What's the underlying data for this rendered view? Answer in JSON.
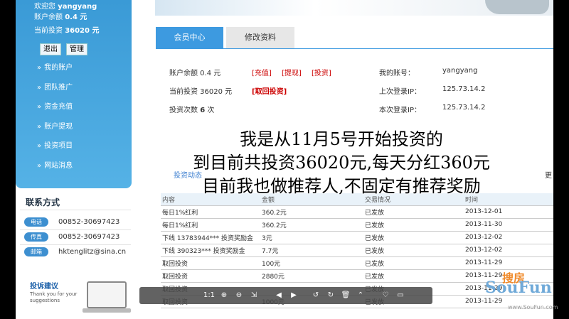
{
  "sidebar": {
    "welcome": "欢迎您",
    "username": "yangyang",
    "balance_label": "账户余额",
    "balance_value": "0.4 元",
    "investment_label": "当前投资",
    "investment_value": "36020 元",
    "logout_label": "退出",
    "manage_label": "管理",
    "menu": [
      "我的账户",
      "团队推广",
      "资金充值",
      "账户提现",
      "投资项目",
      "网站消息"
    ],
    "contact_title": "联系方式",
    "contacts": [
      {
        "tag": "电话",
        "value": "00852-30697423"
      },
      {
        "tag": "传真",
        "value": "00852-30697423"
      },
      {
        "tag": "邮箱",
        "value": "hktenglitz@sina.cn"
      }
    ],
    "feedback_title": "投诉建议",
    "feedback_sub": "Thank you for your suggestions"
  },
  "tabs": [
    "会员中心",
    "修改资料"
  ],
  "account": {
    "balance": "账户余额 0.4 元",
    "actions": [
      "[充值]",
      "[提现]",
      "[投资]"
    ],
    "current": "当前投资 36020 元",
    "withdraw_action": "[取回投资]",
    "count_label": "投资次数",
    "count_value": "6",
    "count_unit": "次",
    "acct_label": "我的账号：",
    "acct_value": "yangyang",
    "last_ip_label": "上次登录IP：",
    "last_ip_value": "125.73.14.2",
    "this_ip_label": "本次登录IP：",
    "this_ip_value": "125.73.14.2"
  },
  "overlay_lines": [
    "我是从11月5号开始投资的",
    "到目前共投资36020元,每天分红360元",
    "目前我也做推荐人,不固定有推荐奖励"
  ],
  "records": {
    "title": "投资动态",
    "more": "更",
    "headers": [
      "内容",
      "金额",
      "交易情况",
      "时间"
    ],
    "rows": [
      [
        "每日1%红利",
        "360.2元",
        "已发放",
        "2013-12-01"
      ],
      [
        "每日1%红利",
        "360.2元",
        "已发放",
        "2013-11-30"
      ],
      [
        "下线 13783944*** 投资奖励金",
        "3元",
        "已发放",
        "2013-12-02"
      ],
      [
        "下线 390323*** 投资奖励金",
        "7.7元",
        "已发放",
        "2013-12-02"
      ],
      [
        "取回投资",
        "100元",
        "已发放",
        "2013-11-29"
      ],
      [
        "取回投资",
        "2880元",
        "已发放",
        "2013-11-29"
      ],
      [
        "取回投资",
        "",
        "已发放",
        "2013-11-29"
      ],
      [
        "取回投资",
        "1000元",
        "已发放",
        "2013-11-29"
      ]
    ]
  },
  "toolbar": [
    "1:1",
    "⊕",
    "⊖",
    "⇲",
    "◀",
    "▶",
    "↺",
    "↻",
    "🗑",
    "⌃",
    "♡",
    "▭"
  ],
  "watermark": {
    "top": "搜房",
    "big": "SouFun",
    "url": "www.SouFun.com"
  }
}
